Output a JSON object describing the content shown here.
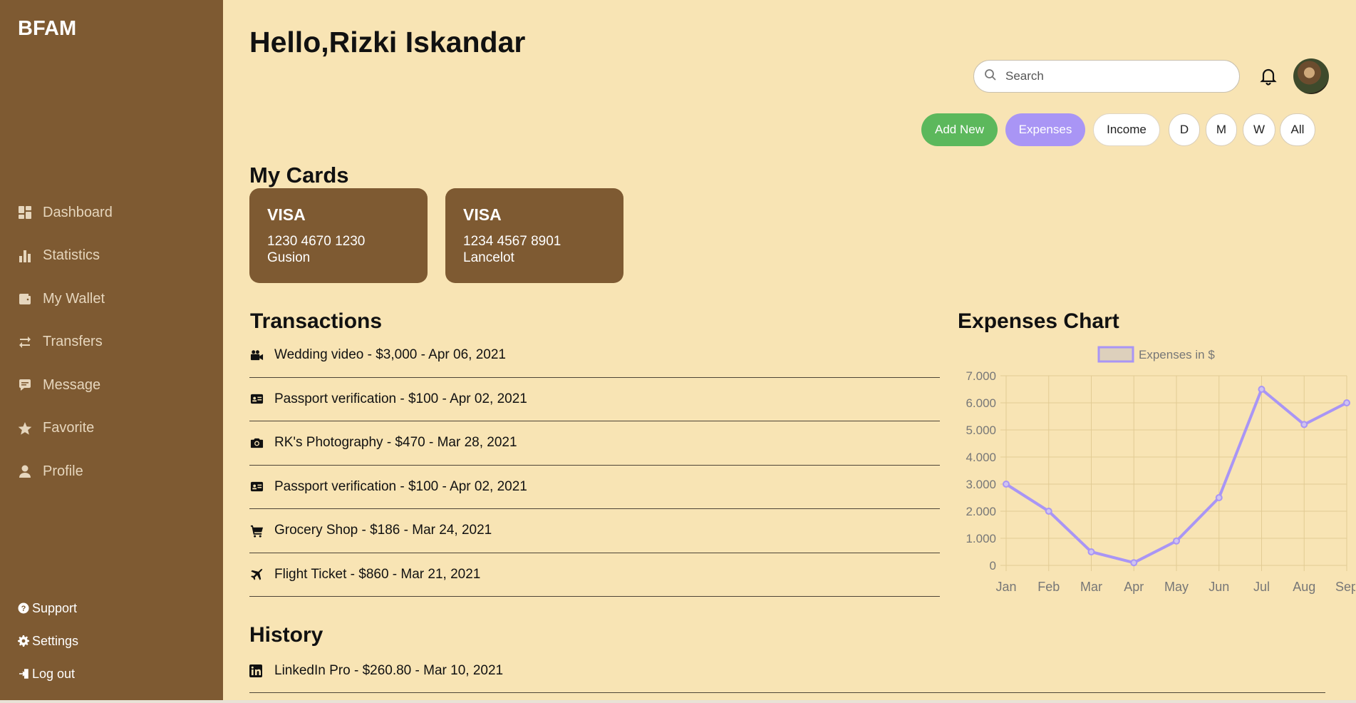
{
  "app": {
    "brand": "BFAM"
  },
  "sidebar": {
    "items": [
      {
        "label": "Dashboard",
        "icon": "dashboard-icon"
      },
      {
        "label": "Statistics",
        "icon": "bar-chart-icon"
      },
      {
        "label": "My Wallet",
        "icon": "wallet-icon"
      },
      {
        "label": "Transfers",
        "icon": "transfer-icon"
      },
      {
        "label": "Message",
        "icon": "message-icon"
      },
      {
        "label": "Favorite",
        "icon": "star-icon"
      },
      {
        "label": "Profile",
        "icon": "user-icon"
      }
    ],
    "bottom": [
      {
        "label": "Support",
        "icon": "help-icon"
      },
      {
        "label": "Settings",
        "icon": "gear-icon"
      },
      {
        "label": "Log out",
        "icon": "logout-icon"
      }
    ]
  },
  "header": {
    "greeting": "Hello,Rizki Iskandar",
    "search_placeholder": "Search"
  },
  "actions": {
    "add_new": "Add New",
    "expenses": "Expenses",
    "income": "Income",
    "day": "D",
    "month": "M",
    "week": "W",
    "all": "All"
  },
  "cards": {
    "title": "My Cards",
    "items": [
      {
        "brand": "VISA",
        "number": "1230 4670 1230",
        "holder": "Gusion"
      },
      {
        "brand": "VISA",
        "number": "1234 4567 8901",
        "holder": "Lancelot"
      }
    ]
  },
  "transactions": {
    "title": "Transactions",
    "items": [
      {
        "text": "Wedding video - $3,000 - Apr 06, 2021",
        "icon": "video-camera-icon"
      },
      {
        "text": "Passport verification - $100 - Apr 02, 2021",
        "icon": "id-card-icon"
      },
      {
        "text": "RK's Photography - $470 - Mar 28, 2021",
        "icon": "camera-icon"
      },
      {
        "text": "Passport verification - $100 - Apr 02, 2021",
        "icon": "id-card-icon"
      },
      {
        "text": "Grocery Shop - $186 - Mar 24, 2021",
        "icon": "cart-icon"
      },
      {
        "text": "Flight Ticket - $860 - Mar 21, 2021",
        "icon": "plane-icon"
      }
    ]
  },
  "history": {
    "title": "History",
    "items": [
      {
        "text": "LinkedIn Pro - $260.80 - Mar 10, 2021",
        "icon": "linkedin-icon"
      }
    ]
  },
  "colors": {
    "background": "#f8e4b4",
    "sidebar": "#7e5a32",
    "accent": "#a995f5",
    "add_button": "#5cb85c"
  },
  "chart_title": "Expenses Chart",
  "chart_data": {
    "type": "line",
    "categories": [
      "Jan",
      "Feb",
      "Mar",
      "Apr",
      "May",
      "Jun",
      "Jul",
      "Aug",
      "Sep"
    ],
    "series": [
      {
        "name": "Expenses in $",
        "values": [
          3000,
          2000,
          500,
          100,
          900,
          2500,
          6500,
          5200,
          6000
        ],
        "color": "#a995f5"
      }
    ],
    "y_ticks": [
      "0",
      "1.000",
      "2.000",
      "3.000",
      "4.000",
      "5.000",
      "6.000",
      "7.000"
    ],
    "ylim": [
      0,
      7000
    ],
    "grid": true,
    "legend": "top"
  }
}
